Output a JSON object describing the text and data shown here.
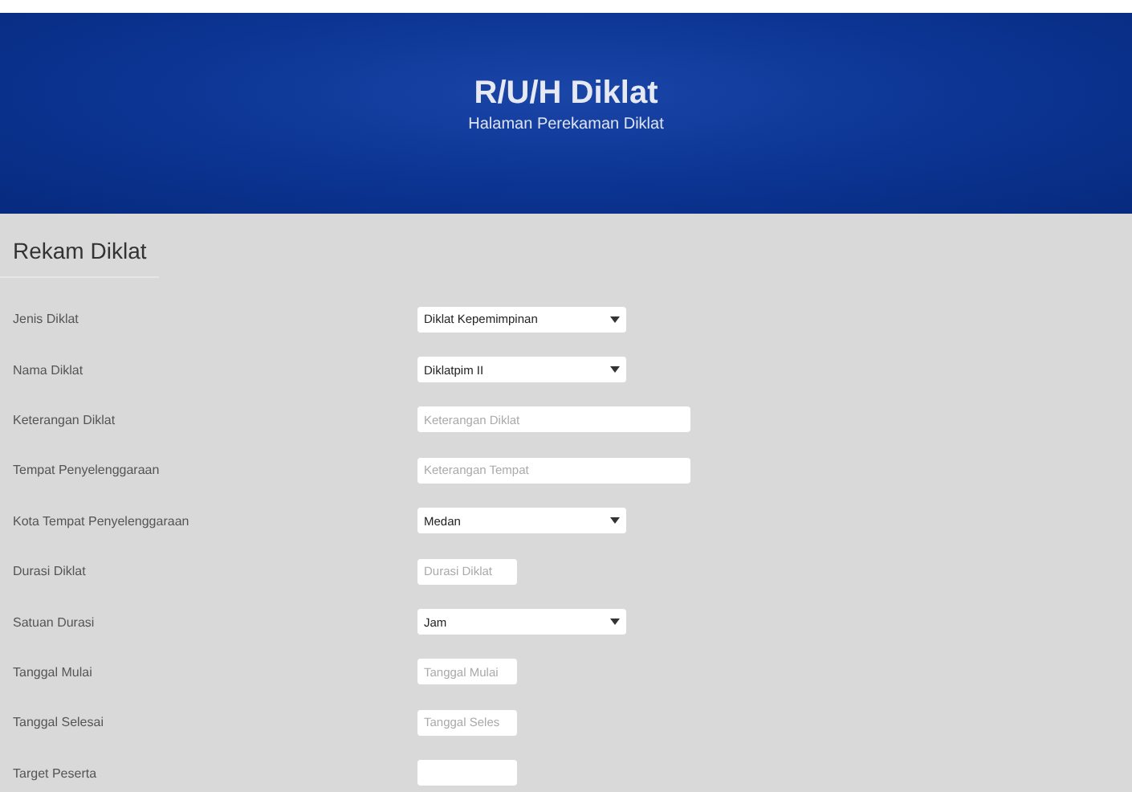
{
  "header": {
    "title": "R/U/H Diklat",
    "subtitle": "Halaman Perekaman Diklat"
  },
  "form": {
    "title": "Rekam Diklat",
    "fields": [
      {
        "label": "Jenis Diklat",
        "kind": "select",
        "value": "Diklat Kepemimpinan"
      },
      {
        "label": "Nama Diklat",
        "kind": "select",
        "value": "Diklatpim II"
      },
      {
        "label": "Keterangan Diklat",
        "kind": "text",
        "placeholder": "Keterangan Diklat"
      },
      {
        "label": "Tempat Penyelenggaraan",
        "kind": "text",
        "placeholder": "Keterangan Tempat"
      },
      {
        "label": "Kota Tempat Penyelenggaraan",
        "kind": "select",
        "value": "Medan"
      },
      {
        "label": "Durasi Diklat",
        "kind": "short",
        "placeholder": "Durasi Diklat"
      },
      {
        "label": "Satuan Durasi",
        "kind": "select",
        "value": "Jam"
      },
      {
        "label": "Tanggal Mulai",
        "kind": "short",
        "placeholder": "Tanggal Mulai"
      },
      {
        "label": "Tanggal Selesai",
        "kind": "short",
        "placeholder": "Tanggal Seles"
      },
      {
        "label": "Target Peserta",
        "kind": "short"
      }
    ]
  }
}
